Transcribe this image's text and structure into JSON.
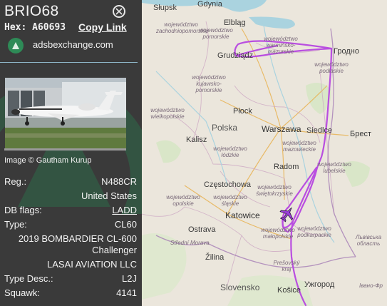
{
  "aircraft": {
    "callsign": "BRIO68",
    "hex_label": "Hex:",
    "hex": "A60693",
    "copy_link": "Copy Link",
    "source": "adsbexchange.com",
    "image_credit": "Image © Gautham Kurup",
    "reg_label": "Reg.:",
    "reg": "N488CR",
    "country": "United States",
    "db_flags_label": "DB flags:",
    "db_flags": "LADD",
    "type_label": "Type:",
    "type": "CL60",
    "model_line1": "2019 BOMBARDIER CL-600",
    "model_line2": "Challenger",
    "operator": "LASAI AVIATION LLC",
    "type_desc_label": "Type Desc.:",
    "type_desc": "L2J",
    "squawk_label": "Squawk:",
    "squawk": "4141"
  },
  "colors": {
    "panel_bg": "#3a3a3a",
    "track": "#b94ee0",
    "source_logo": "#2e8b57",
    "aircraft_icon": "#9b3fd9"
  },
  "map": {
    "labels": {
      "slupsk": "Słupsk",
      "gdynia": "Gdynia",
      "elblag": "Elbląg",
      "grudziadz": "Grudziądz",
      "plock": "Płock",
      "polska": "Polska",
      "warszawa": "Warszawa",
      "siedlce": "Siedlce",
      "kalisz": "Kalisz",
      "radom": "Radom",
      "czestochowa": "Częstochowa",
      "katowice": "Katowice",
      "ostrava": "Ostrava",
      "zilina": "Žilina",
      "slovensko": "Slovensko",
      "kosice": "Košice",
      "hrodna": "Гродно",
      "brest": "Брест",
      "lviv": "Львівська область",
      "uzhhorod": "Ужгород",
      "presov": "Prešovský kraj",
      "ivano": "Івано-Фр",
      "stredni_morava": "Střední Morava",
      "zachodniopomorskie": "województwo zachodniopomorskie",
      "pomorskie": "województwo pomorskie",
      "warminsko": "województwo warmińsko-mazurskie",
      "podlaskie": "województwo podlaskie",
      "kujawsko": "województwo kujawsko-pomorskie",
      "wielkopolskie": "województwo wielkopolskie",
      "mazowieckie": "województwo mazowieckie",
      "lodzkie": "województwo łódzkie",
      "lubelskie": "województwo lubelskie",
      "swietokrzyskie": "województwo świętokrzyskie",
      "opolskie": "województwo opolskie",
      "slaskie": "województwo śląskie",
      "malopolskie": "województwo małopolskie",
      "podkarpackie": "województwo podkarpackie"
    }
  }
}
